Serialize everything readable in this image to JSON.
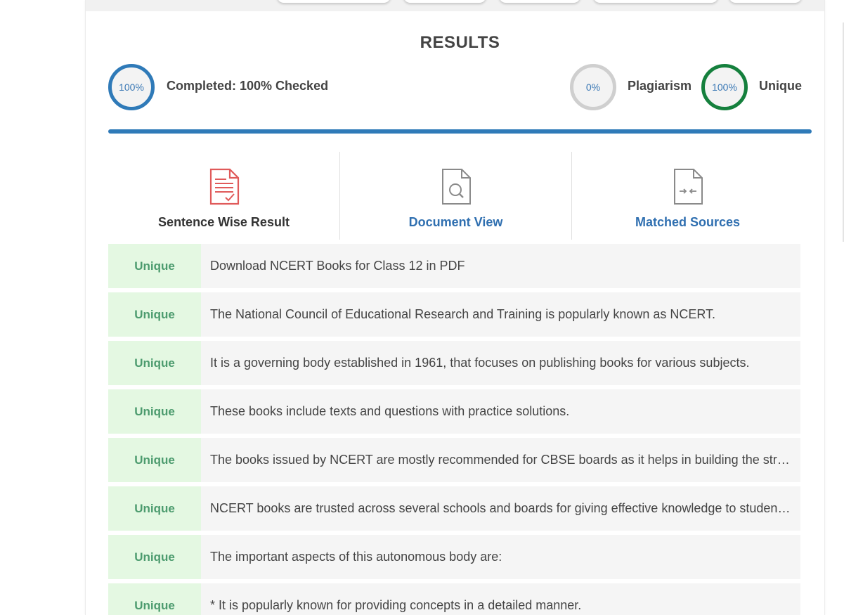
{
  "results": {
    "title": "RESULTS",
    "completed": {
      "percent_text": "100%",
      "label": "Completed: 100% Checked",
      "value": 1.0
    },
    "plagiarism": {
      "percent_text": "0%",
      "label": "Plagiarism",
      "value": 0.0
    },
    "unique": {
      "percent_text": "100%",
      "label": "Unique",
      "value": 1.0
    },
    "progress": 1.0
  },
  "tabs": [
    {
      "label": "Sentence Wise Result",
      "icon": "sentence-report-icon",
      "active": true
    },
    {
      "label": "Document View",
      "icon": "document-search-icon",
      "active": false
    },
    {
      "label": "Matched Sources",
      "icon": "compare-document-icon",
      "active": false
    }
  ],
  "sentences": [
    {
      "status": "Unique",
      "text": "Download NCERT Books for Class 12 in PDF"
    },
    {
      "status": "Unique",
      "text": "The National Council of Educational Research and Training is popularly known as NCERT."
    },
    {
      "status": "Unique",
      "text": "It is a governing body established in 1961, that focuses on publishing books for various subjects."
    },
    {
      "status": "Unique",
      "text": "These books include texts and questions with practice solutions."
    },
    {
      "status": "Unique",
      "text": "The books issued by NCERT are mostly recommended for CBSE boards as it helps in building the str…"
    },
    {
      "status": "Unique",
      "text": "NCERT books are trusted across several schools and boards for giving effective knowledge to studen…"
    },
    {
      "status": "Unique",
      "text": "The important aspects of this autonomous body are:"
    },
    {
      "status": "Unique",
      "text": "* It is popularly known for providing concepts in a detailed manner."
    }
  ],
  "colors": {
    "accent_blue": "#2f7ab8",
    "unique_green": "#15803d",
    "plagiarism_gray": "#cfcfcf",
    "sentence_tab_red": "#e05a5a",
    "unique_badge_bg": "#e4f8e2",
    "unique_badge_text": "#4c9b6e"
  }
}
